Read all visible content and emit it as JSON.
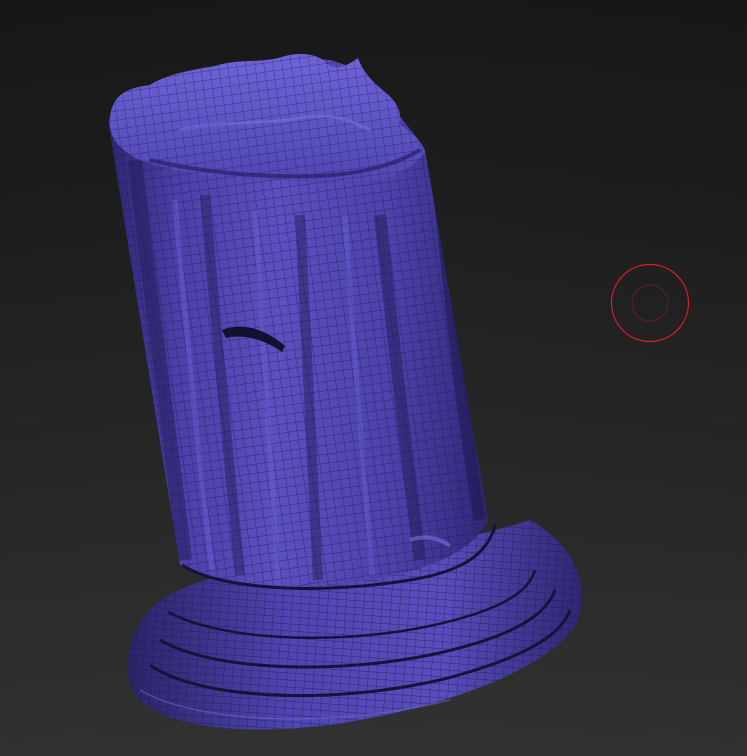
{
  "viewport": {
    "background": "#262626",
    "model_color": "#4a40a8",
    "wire_color": "#1a1640",
    "cursor_color": "#d8202a"
  },
  "model": {
    "name": "sculpted-broken-column",
    "polyframe_visible": true
  },
  "brush_cursor": {
    "visible": true
  }
}
